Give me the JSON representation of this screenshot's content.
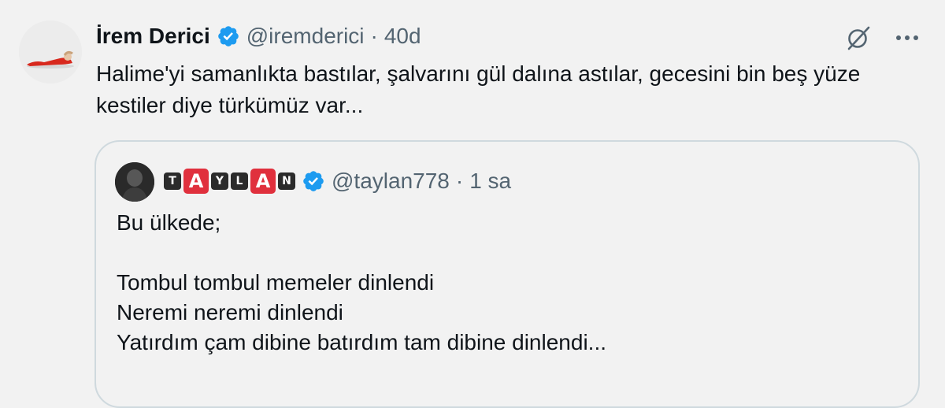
{
  "tweet": {
    "author_name": "İrem Derici",
    "handle": "@iremderici",
    "separator": "·",
    "time": "40d",
    "text": "Halime'yi samanlıkta bastılar, şalvarını gül dalına astılar, gecesini bin beş yüze kestiler diye türkümüz var...",
    "avatar_icon": "avatar-photo",
    "verified_icon": "verified-badge-icon",
    "grok_icon": "grok-icon",
    "more_icon": "more-dots-icon"
  },
  "quote": {
    "author_letters": [
      "T",
      "A",
      "Y",
      "L",
      "A",
      "N"
    ],
    "handle": "@taylan778",
    "separator": "·",
    "time": "1 sa",
    "lines": [
      "Bu ülkede;",
      "",
      "Tombul tombul memeler dinlendi",
      "Neremi neremi dinlendi",
      "Yatırdım çam dibine batırdım tam dibine dinlendi..."
    ]
  },
  "colors": {
    "background": "#f2f2f2",
    "text": "#0f1419",
    "secondary_text": "#536471",
    "verified_blue": "#1d9bf0",
    "border": "#cfd9de",
    "letter_red": "#e0303d",
    "letter_dark": "#2b2b2b"
  }
}
